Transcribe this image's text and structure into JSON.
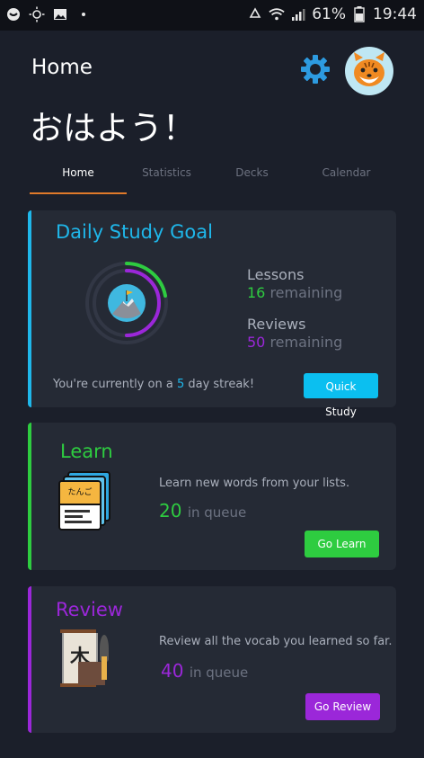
{
  "status_bar": {
    "battery": "61%",
    "time": "19:44"
  },
  "header": {
    "title": "Home",
    "greeting": "おはよう！"
  },
  "tabs": [
    {
      "label": "Home",
      "active": true
    },
    {
      "label": "Statistics",
      "active": false
    },
    {
      "label": "Decks",
      "active": false
    },
    {
      "label": "Calendar",
      "active": false
    }
  ],
  "daily_goal": {
    "title": "Daily Study Goal",
    "lessons_label": "Lessons",
    "lessons_count": "16",
    "lessons_suffix": "remaining",
    "reviews_label": "Reviews",
    "reviews_count": "50",
    "reviews_suffix": "remaining",
    "streak_prefix": "You're currently on a",
    "streak_days": "5",
    "streak_suffix": "day streak!",
    "button": "Quick Study"
  },
  "learn": {
    "title": "Learn",
    "card_text": "たんご",
    "description": "Learn new words from your lists.",
    "count": "20",
    "count_suffix": "in queue",
    "button": "Go Learn"
  },
  "review": {
    "title": "Review",
    "kanji": "木",
    "description": "Review all the vocab you learned so far.",
    "count": "40",
    "count_suffix": "in queue",
    "button": "Go Review"
  },
  "colors": {
    "accent_blue": "#1fb7ea",
    "green": "#2ecc40",
    "purple": "#9b27d9",
    "tab_underline": "#e07a2a"
  }
}
